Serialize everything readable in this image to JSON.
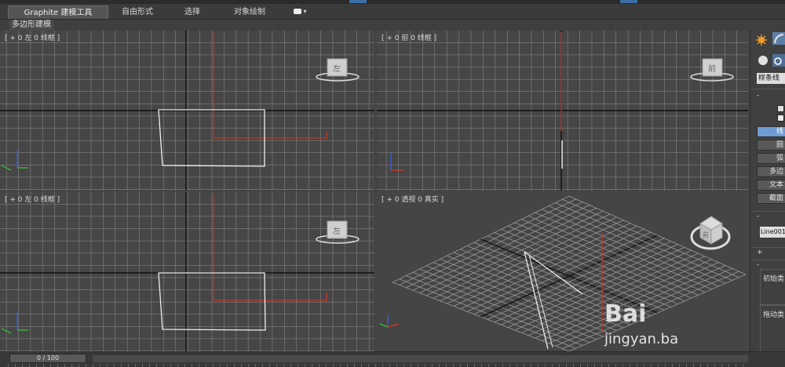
{
  "ribbon": {
    "tabs": [
      {
        "label": "Graphite 建模工具",
        "active": true
      },
      {
        "label": "自由形式",
        "active": false
      },
      {
        "label": "选择",
        "active": false
      },
      {
        "label": "对象绘制",
        "active": false
      }
    ],
    "sub_label": "多边形建模"
  },
  "viewports": {
    "top_left": {
      "label": "[ + 0 左 0 线框 ]",
      "cube_face": "左",
      "active": true
    },
    "top_right": {
      "label": "[ + 0 前 0 线框 ]",
      "cube_face": "前",
      "active": false
    },
    "bottom_left": {
      "label": "[ + 0 左 0 线框 ]",
      "cube_face": "左",
      "active": false
    },
    "bottom_right": {
      "label": "[ + 0 透视 0 真实 ]",
      "cube_face": "前",
      "active": false
    }
  },
  "command_panel": {
    "category_dropdown": "样条线",
    "minus_sign": "-",
    "plus_sign": "+",
    "object_buttons": [
      {
        "label": "线",
        "selected": true
      },
      {
        "label": "圆",
        "selected": false
      },
      {
        "label": "弧",
        "selected": false
      },
      {
        "label": "多边",
        "selected": false
      },
      {
        "label": "文本",
        "selected": false
      },
      {
        "label": "截面",
        "selected": false
      }
    ],
    "name_field": "Line001",
    "initial_type_label": "初始类",
    "drag_type_label": "拖动类"
  },
  "timeline": {
    "frame_display": "0 / 100"
  },
  "watermark": {
    "text": "jingyan.ba",
    "logo": "Bai"
  },
  "colors": {
    "background": "#444444",
    "grid": "#8c8c8c",
    "active_border": "#b8962e",
    "selected_button": "#6f9bd2",
    "red_axis": "#c0392b"
  }
}
